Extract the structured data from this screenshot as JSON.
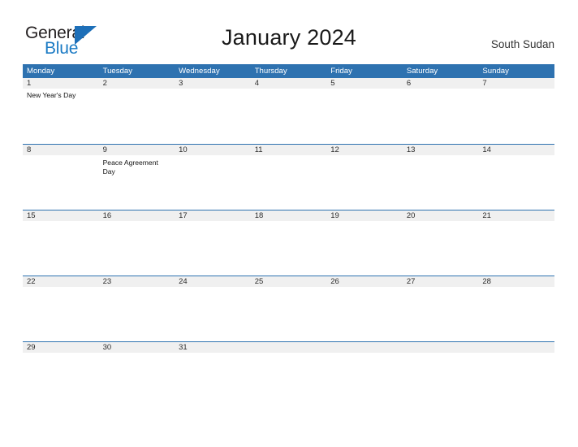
{
  "brand": {
    "name_part1": "General",
    "name_part2": "Blue",
    "triangle_icon": "triangle-logo-icon",
    "color_dark": "#231f20",
    "color_blue": "#1a7ac4"
  },
  "header": {
    "title": "January 2024",
    "region": "South Sudan"
  },
  "theme": {
    "header_blue": "#2e72b0",
    "band_gray": "#f0f0f0",
    "text_dark": "#2b2b2b"
  },
  "calendar": {
    "month": "January",
    "year": "2024",
    "weekday_headers": [
      "Monday",
      "Tuesday",
      "Wednesday",
      "Thursday",
      "Friday",
      "Saturday",
      "Sunday"
    ],
    "weeks": [
      {
        "days": [
          {
            "num": "1",
            "event": "New Year's Day"
          },
          {
            "num": "2",
            "event": ""
          },
          {
            "num": "3",
            "event": ""
          },
          {
            "num": "4",
            "event": ""
          },
          {
            "num": "5",
            "event": ""
          },
          {
            "num": "6",
            "event": ""
          },
          {
            "num": "7",
            "event": ""
          }
        ]
      },
      {
        "days": [
          {
            "num": "8",
            "event": ""
          },
          {
            "num": "9",
            "event": "Peace Agreement Day"
          },
          {
            "num": "10",
            "event": ""
          },
          {
            "num": "11",
            "event": ""
          },
          {
            "num": "12",
            "event": ""
          },
          {
            "num": "13",
            "event": ""
          },
          {
            "num": "14",
            "event": ""
          }
        ]
      },
      {
        "days": [
          {
            "num": "15",
            "event": ""
          },
          {
            "num": "16",
            "event": ""
          },
          {
            "num": "17",
            "event": ""
          },
          {
            "num": "18",
            "event": ""
          },
          {
            "num": "19",
            "event": ""
          },
          {
            "num": "20",
            "event": ""
          },
          {
            "num": "21",
            "event": ""
          }
        ]
      },
      {
        "days": [
          {
            "num": "22",
            "event": ""
          },
          {
            "num": "23",
            "event": ""
          },
          {
            "num": "24",
            "event": ""
          },
          {
            "num": "25",
            "event": ""
          },
          {
            "num": "26",
            "event": ""
          },
          {
            "num": "27",
            "event": ""
          },
          {
            "num": "28",
            "event": ""
          }
        ]
      },
      {
        "days": [
          {
            "num": "29",
            "event": ""
          },
          {
            "num": "30",
            "event": ""
          },
          {
            "num": "31",
            "event": ""
          },
          {
            "num": "",
            "event": ""
          },
          {
            "num": "",
            "event": ""
          },
          {
            "num": "",
            "event": ""
          },
          {
            "num": "",
            "event": ""
          }
        ]
      }
    ]
  }
}
